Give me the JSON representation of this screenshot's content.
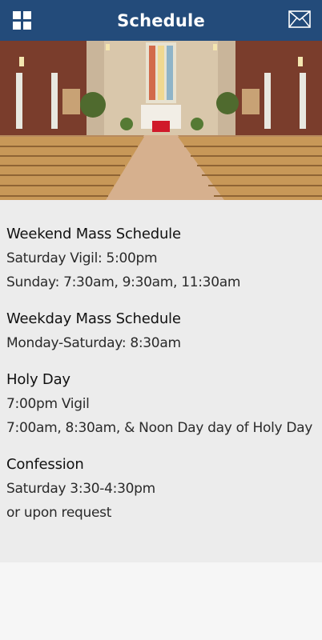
{
  "header": {
    "title": "Schedule",
    "menu_icon": "grid-menu-icon",
    "mail_icon": "mail-icon",
    "bg_color": "#234b7a"
  },
  "hero": {
    "image": "church-interior-photo"
  },
  "sections": [
    {
      "title": "Weekend Mass Schedule",
      "lines": [
        "Saturday Vigil: 5:00pm",
        "Sunday: 7:30am, 9:30am, 11:30am"
      ]
    },
    {
      "title": "Weekday Mass Schedule",
      "lines": [
        "Monday-Saturday: 8:30am"
      ]
    },
    {
      "title": "Holy Day",
      "lines": [
        "7:00pm Vigil",
        "7:00am, 8:30am, & Noon Day day of Holy Day"
      ]
    },
    {
      "title": "Confession",
      "lines": [
        "Saturday 3:30-4:30pm",
        "or upon request"
      ]
    }
  ]
}
